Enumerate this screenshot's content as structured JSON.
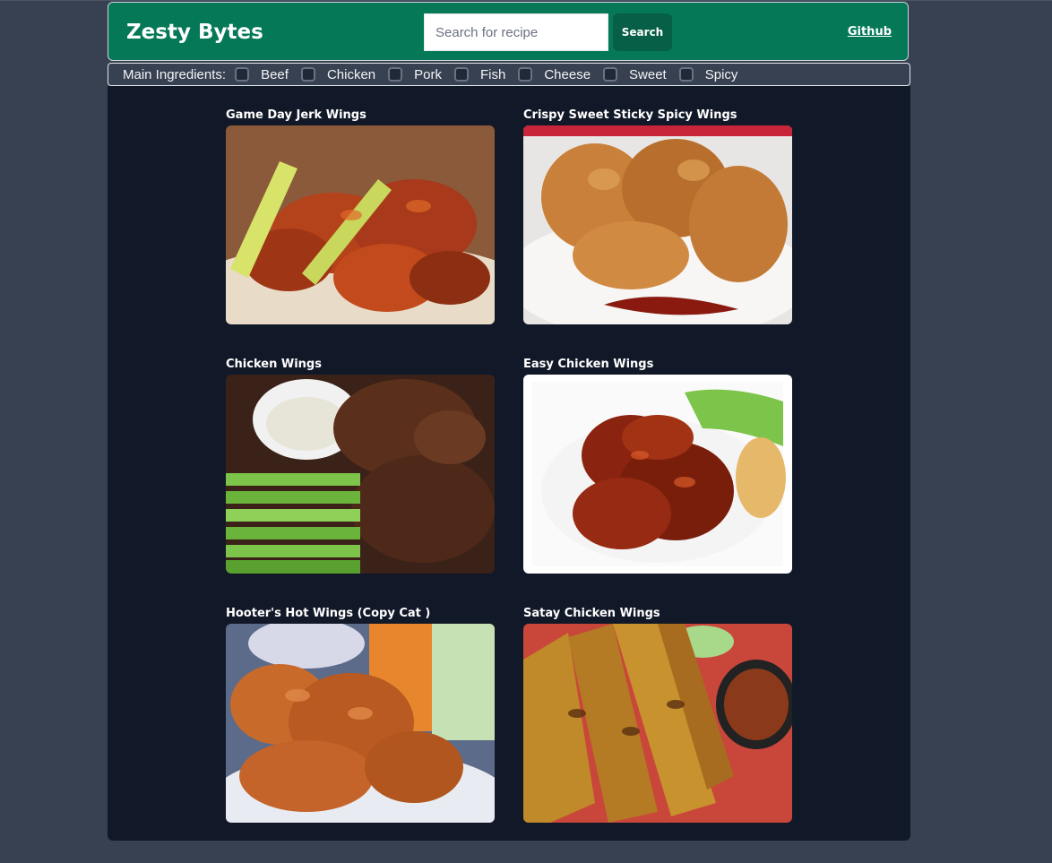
{
  "header": {
    "brand": "Zesty Bytes",
    "search_placeholder": "Search for recipe",
    "search_value": "",
    "search_button": "Search",
    "github_link": "Github"
  },
  "filters": {
    "label": "Main Ingredients:",
    "options": [
      {
        "label": "Beef",
        "checked": false
      },
      {
        "label": "Chicken",
        "checked": false
      },
      {
        "label": "Pork",
        "checked": false
      },
      {
        "label": "Fish",
        "checked": false
      },
      {
        "label": "Cheese",
        "checked": false
      },
      {
        "label": "Sweet",
        "checked": false
      },
      {
        "label": "Spicy",
        "checked": false
      }
    ]
  },
  "recipes": [
    {
      "title": "Game Day Jerk Wings",
      "image": "jerk-wings-photo"
    },
    {
      "title": "Crispy Sweet Sticky Spicy Wings",
      "image": "crispy-wings-photo"
    },
    {
      "title": "Chicken Wings",
      "image": "chicken-wings-celery-photo"
    },
    {
      "title": "Easy Chicken Wings",
      "image": "easy-chicken-wings-photo"
    },
    {
      "title": "Hooter's Hot Wings (Copy Cat )",
      "image": "hot-wings-photo"
    },
    {
      "title": "Satay Chicken Wings",
      "image": "satay-wings-photo"
    }
  ],
  "colors": {
    "header_bg": "#047857",
    "page_bg": "#374151",
    "content_bg": "#111827",
    "button_bg": "#065f46"
  }
}
